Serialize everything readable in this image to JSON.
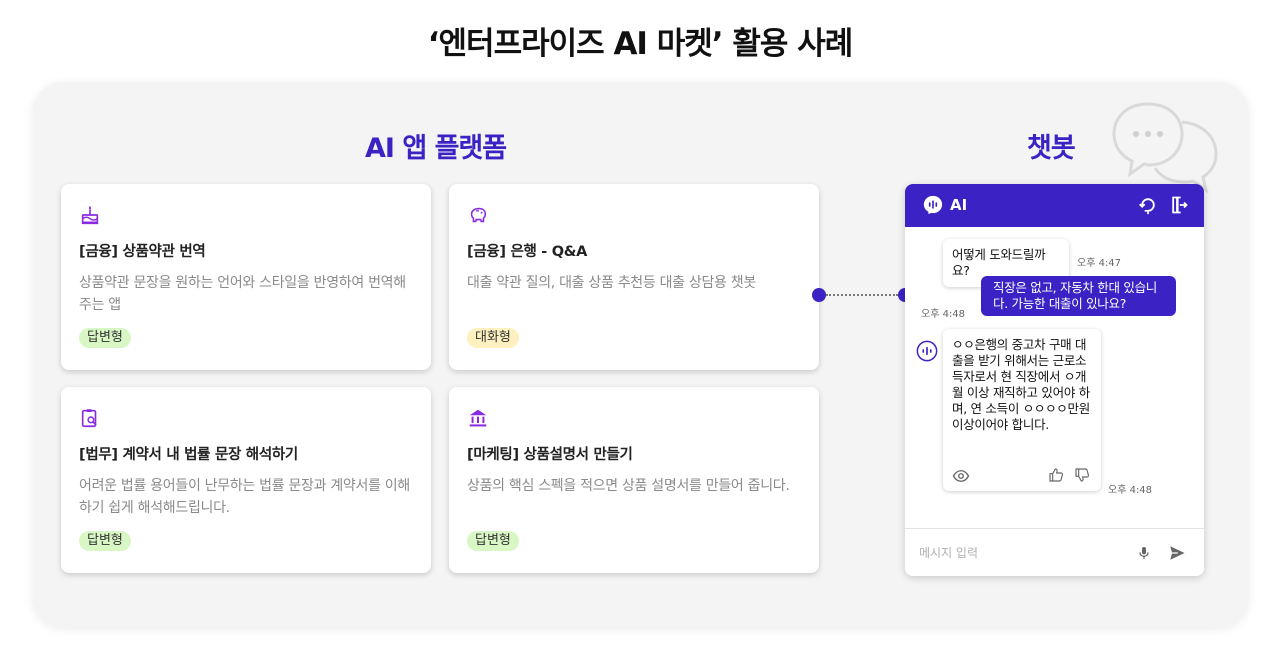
{
  "page_title": "‘엔터프라이즈 AI 마켓’ 활용 사례",
  "apps_section": {
    "title": "AI 앱 플랫폼",
    "cards": [
      {
        "title": "[금융] 상품약관 번역",
        "desc": "상품약관 문장을 원하는 언어와 스타일을 반영하여 번역해주는 앱",
        "tag": "답변형",
        "icon": "cake-icon"
      },
      {
        "title": "[금융] 은행 - Q&A",
        "desc": "대출 약관 질의, 대출 상품 추천등 대출 상담용 챗봇",
        "tag": "대화형",
        "icon": "piggy-bank-icon"
      },
      {
        "title": "[법무] 계약서 내 법률 문장 해석하기",
        "desc": "어려운 법률 용어들이 난무하는 법률 문장과 계약서를 이해하기 쉽게 해석해드립니다.",
        "tag": "답변형",
        "icon": "clipboard-search-icon"
      },
      {
        "title": "[마케팅] 상품설명서 만들기",
        "desc": "상품의 핵심 스펙을 적으면 상품 설명서를 만들어 줍니다.",
        "tag": "답변형",
        "icon": "bank-icon"
      }
    ]
  },
  "chatbot_section": {
    "title": "챗봇",
    "header_title": "AI",
    "messages": [
      {
        "from": "bot",
        "text": "어떻게 도와드릴까요?",
        "time": "오후 4:47"
      },
      {
        "from": "user",
        "text": "직장은 없고, 자동차 한대 있습니다. 가능한 대출이 있나요?",
        "time": "오후 4:48"
      },
      {
        "from": "bot",
        "text": "ㅇㅇ은행의 중고차 구매 대출을 받기 위해서는 근로소득자로서 현 직장에서 ㅇ개월 이상 재직하고 있어야 하며, 연 소득이 ㅇㅇㅇㅇ만원 이상이어야 합니다.",
        "time": "오후 4:48"
      }
    ],
    "input_placeholder": "메시지 입력"
  },
  "colors": {
    "accent": "#3a22c4",
    "panel_bg": "#f4f4f4",
    "tag_green": "#d9f7c5",
    "tag_yellow": "#fff0bf",
    "icon_purple": "#8a2be2"
  }
}
